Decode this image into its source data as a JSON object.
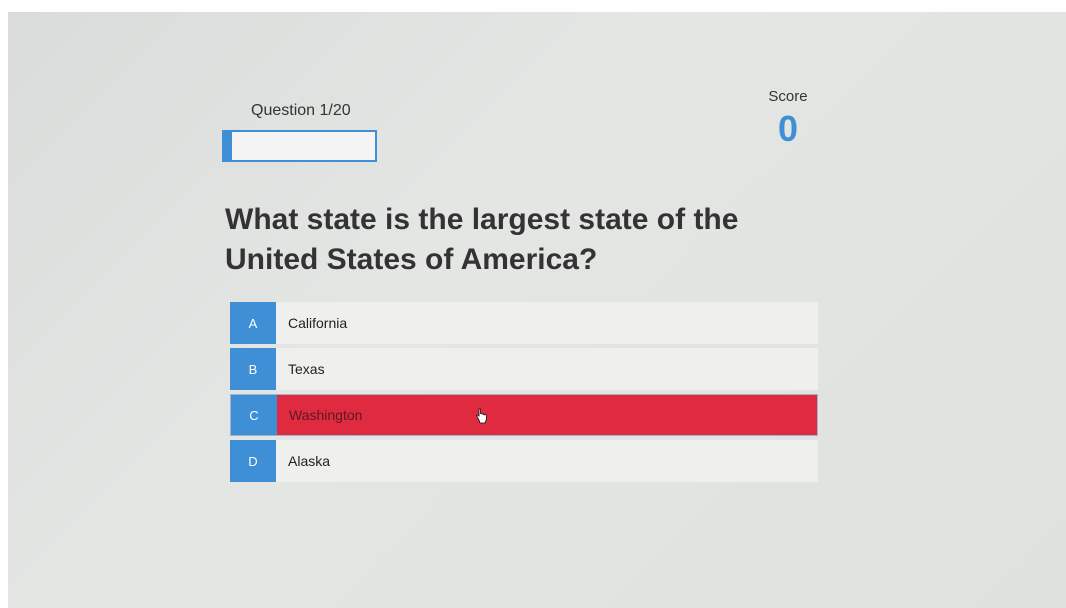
{
  "quiz": {
    "question_counter": "Question 1/20",
    "progress_fraction": 0.05,
    "score_label": "Score",
    "score_value": "0",
    "question": "What state is the largest state of the United States of America?",
    "answers": [
      {
        "letter": "A",
        "text": "California",
        "selected": false
      },
      {
        "letter": "B",
        "text": "Texas",
        "selected": false
      },
      {
        "letter": "C",
        "text": "Washington",
        "selected": true
      },
      {
        "letter": "D",
        "text": "Alaska",
        "selected": false
      }
    ]
  },
  "colors": {
    "accent": "#3f8fd6",
    "selected": "#e02a3f",
    "answer_bg": "#efefed"
  },
  "icons": {
    "cursor": "hand-pointer-icon"
  }
}
